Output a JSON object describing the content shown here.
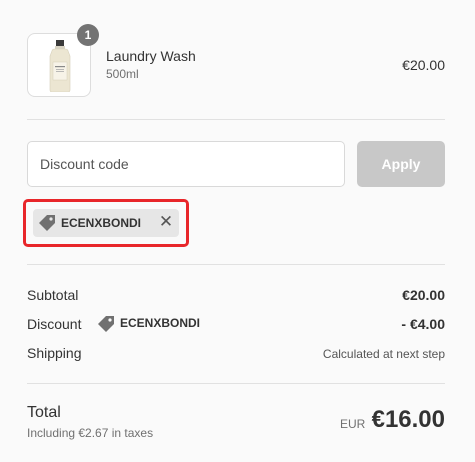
{
  "line_item": {
    "quantity": "1",
    "name": "Laundry Wash",
    "variant": "500ml",
    "price": "€20.00",
    "image_icon": "bottle-image"
  },
  "discount": {
    "placeholder": "Discount code",
    "apply_label": "Apply",
    "applied_tag": "ECENXBONDI",
    "tag_icon": "tag-icon",
    "remove_icon": "close-icon",
    "remove_glyph": "✕"
  },
  "summary": {
    "subtotal_label": "Subtotal",
    "subtotal_value": "€20.00",
    "discount_label": "Discount",
    "discount_code": "ECENXBONDI",
    "discount_value": "- €4.00",
    "shipping_label": "Shipping",
    "shipping_value": "Calculated at next step"
  },
  "total": {
    "label": "Total",
    "tax_note": "Including €2.67 in taxes",
    "currency": "EUR",
    "amount": "€16.00"
  },
  "colors": {
    "highlight": "#e8262a",
    "apply_disabled": "#c8c8c8",
    "badge": "#737373"
  }
}
